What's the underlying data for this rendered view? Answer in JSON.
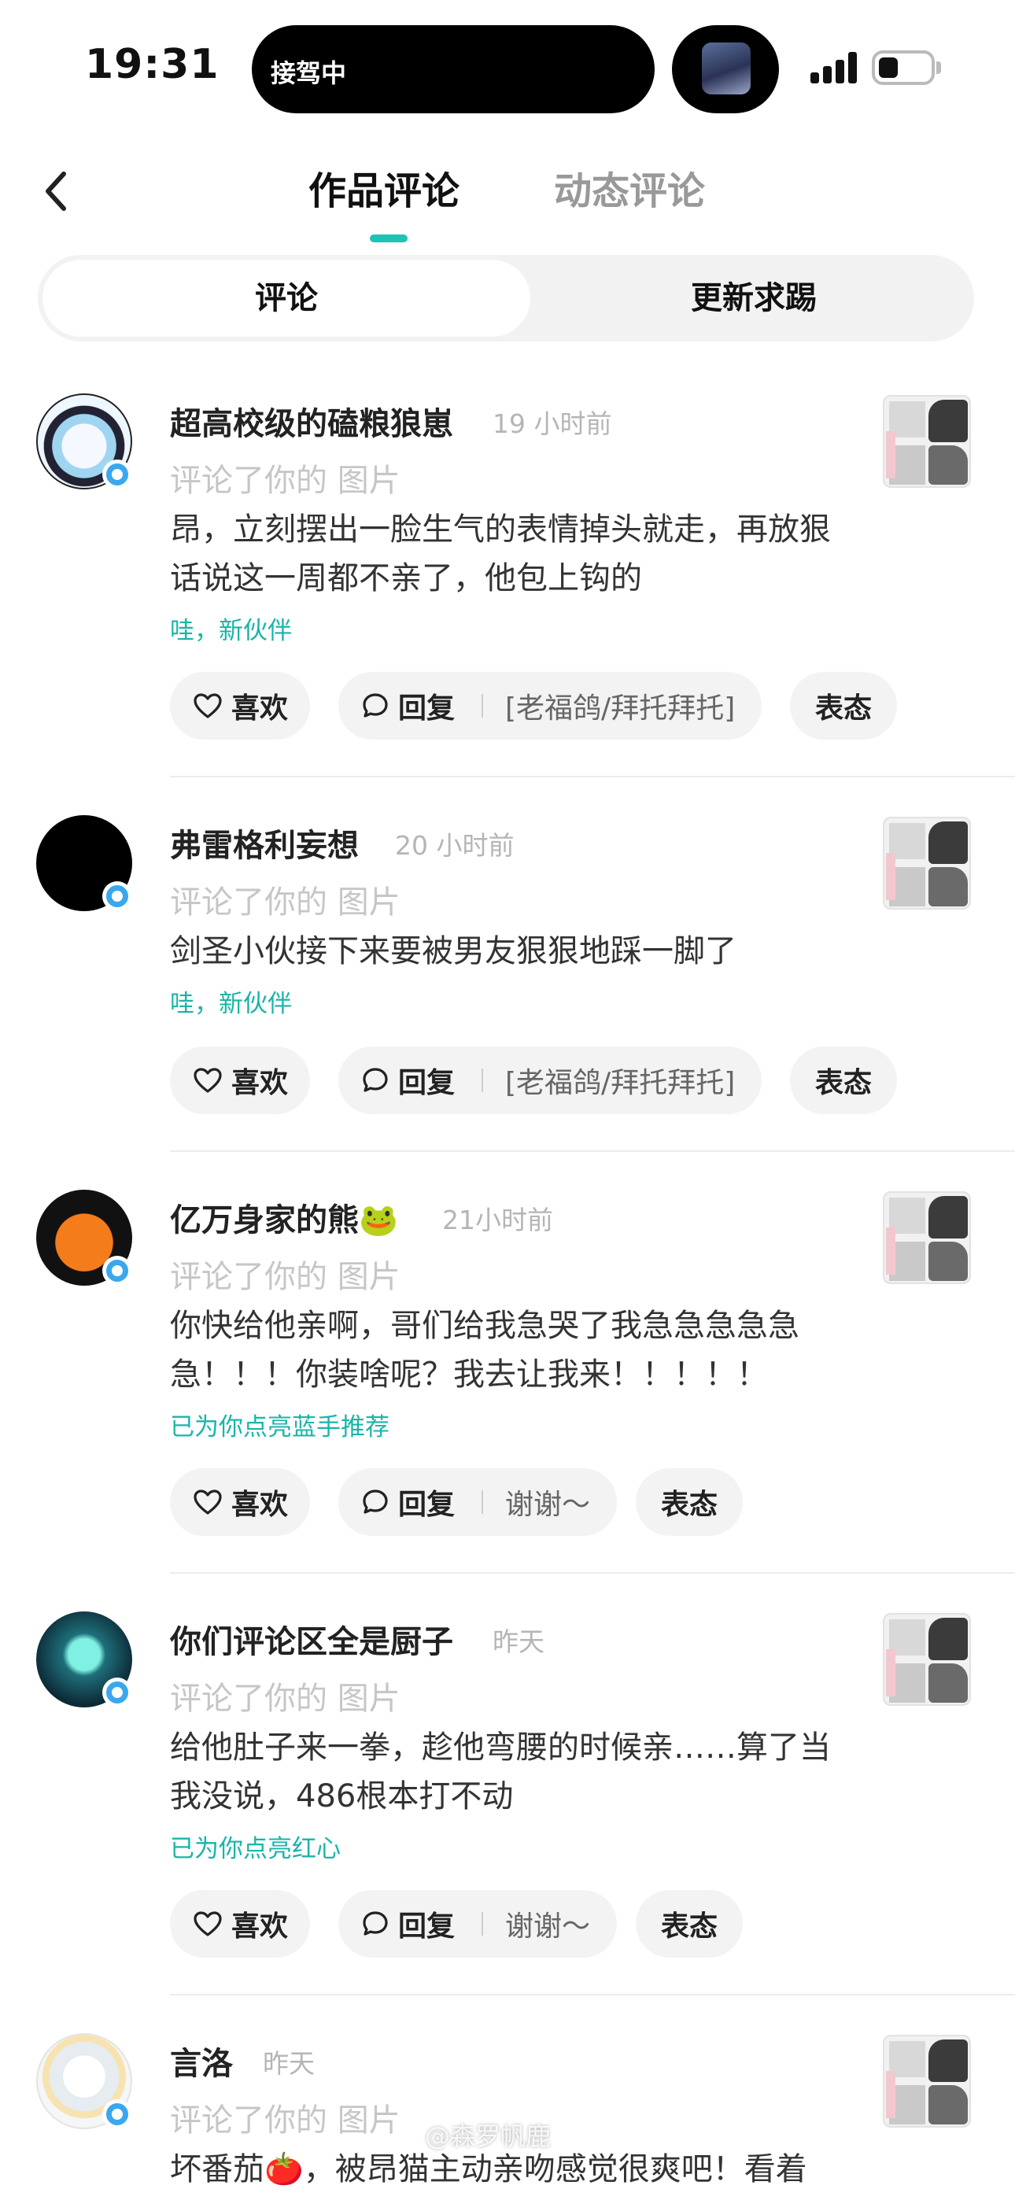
{
  "status_bar": {
    "time": "19:31",
    "activity": "接驾中"
  },
  "header": {
    "tabs": [
      {
        "label": "作品评论",
        "active": true
      },
      {
        "label": "动态评论",
        "active": false
      }
    ]
  },
  "segmented": {
    "options": [
      "评论",
      "更新求踢"
    ],
    "selected": "评论"
  },
  "comments": [
    {
      "username": "超高校级的磕粮狼崽",
      "time": "19 小时前",
      "action": "评论了你的 图片",
      "text": "昂，立刻摆出一脸生气的表情掉头就走，再放狠话说这一周都不亲了，他包上钩的",
      "badge": "哇，新伙伴",
      "like_label": "喜欢",
      "reply_label": "回复",
      "quick_reply": "[老福鸽/拜托拜托]",
      "attitude_label": "表态"
    },
    {
      "username": "弗雷格利妄想",
      "time": "20 小时前",
      "action": "评论了你的 图片",
      "text": "剑圣小伙接下来要被男友狠狠地踩一脚了",
      "badge": "哇，新伙伴",
      "like_label": "喜欢",
      "reply_label": "回复",
      "quick_reply": "[老福鸽/拜托拜托]",
      "attitude_label": "表态"
    },
    {
      "username": "亿万身家的熊🐸",
      "time": "21小时前",
      "action": "评论了你的 图片",
      "text": "你快给他亲啊，哥们给我急哭了我急急急急急急！！！你装啥呢？我去让我来！！！！！",
      "badge": "已为你点亮蓝手推荐",
      "like_label": "喜欢",
      "reply_label": "回复",
      "quick_reply": "谢谢～",
      "attitude_label": "表态"
    },
    {
      "username": "你们评论区全是厨子",
      "time": "昨天",
      "action": "评论了你的 图片",
      "text": "给他肚子来一拳，趁他弯腰的时候亲……算了当我没说，486根本打不动",
      "badge": "已为你点亮红心",
      "like_label": "喜欢",
      "reply_label": "回复",
      "quick_reply": "谢谢～",
      "attitude_label": "表态"
    },
    {
      "username": "言洛",
      "time": "昨天",
      "action": "评论了你的 图片",
      "text": "坏番茄🍅，被昂猫主动亲吻感觉很爽吧！看着"
    }
  ],
  "watermark": "@森罗帆鹿",
  "colors": {
    "accent": "#1cc4b6",
    "badge": "#19b5a8",
    "verified": "#3aa7ee"
  }
}
